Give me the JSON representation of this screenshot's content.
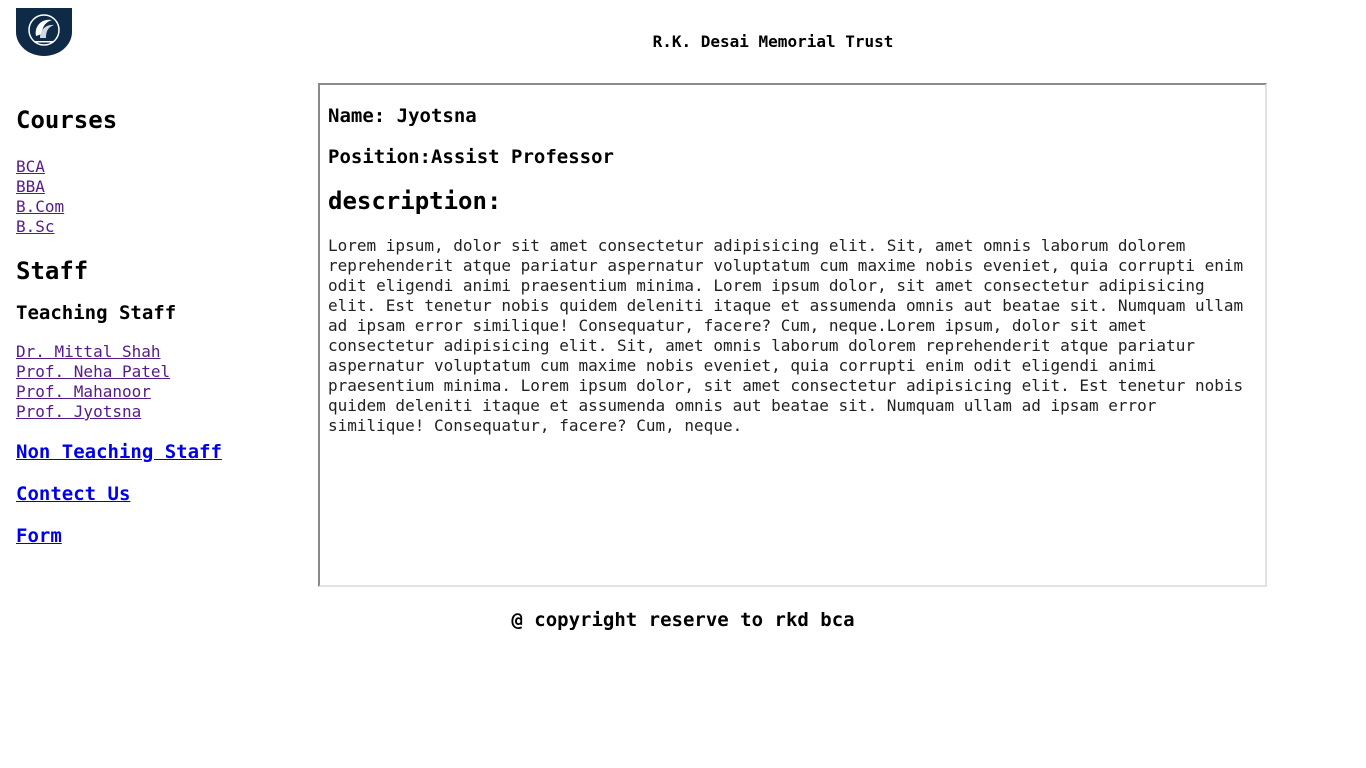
{
  "header": {
    "title": "R.K. Desai Memorial Trust",
    "logo_icon": "college-crest-logo"
  },
  "sidebar": {
    "courses_heading": "Courses",
    "courses": [
      "BCA",
      "BBA",
      "B.Com",
      "B.Sc"
    ],
    "staff_heading": "Staff",
    "teaching_heading": "Teaching Staff",
    "teaching_staff": [
      "Dr. Mittal Shah",
      "Prof. Neha Patel",
      "Prof. Mahanoor",
      "Prof. Jyotsna"
    ],
    "non_teaching_link": "Non Teaching Staff",
    "contact_link": "Contect Us",
    "form_link": "Form"
  },
  "profile": {
    "name": "Name: Jyotsna",
    "position": "Position:Assist Professor",
    "description_heading": "description:",
    "description": "Lorem ipsum, dolor sit amet consectetur adipisicing elit. Sit, amet omnis laborum dolorem reprehenderit atque pariatur aspernatur voluptatum cum maxime nobis eveniet, quia corrupti enim odit eligendi animi praesentium minima. Lorem ipsum dolor, sit amet consectetur adipisicing elit. Est tenetur nobis quidem deleniti itaque et assumenda omnis aut beatae sit. Numquam ullam ad ipsam error similique! Consequatur, facere? Cum, neque.Lorem ipsum, dolor sit amet consectetur adipisicing elit. Sit, amet omnis laborum dolorem reprehenderit atque pariatur aspernatur voluptatum cum maxime nobis eveniet, quia corrupti enim odit eligendi animi praesentium minima. Lorem ipsum dolor, sit amet consectetur adipisicing elit. Est tenetur nobis quidem deleniti itaque et assumenda omnis aut beatae sit. Numquam ullam ad ipsam error similique! Consequatur, facere? Cum, neque."
  },
  "footer": {
    "text": "@ copyright reserve to rkd bca"
  },
  "colors": {
    "visited_link": "#551a8b",
    "link": "#0000ee",
    "logo_bg": "#0f2a47"
  }
}
